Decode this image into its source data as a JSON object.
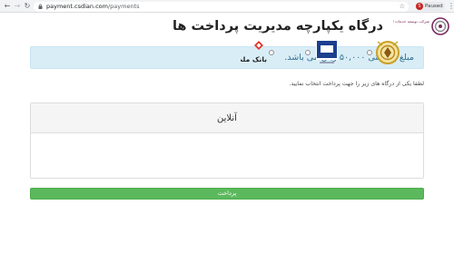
{
  "browser": {
    "url_host": "payment.csdian.com",
    "url_path": "/payments",
    "profile_initial": "S",
    "profile_label": "Paused"
  },
  "header": {
    "logo_text": "شرکت توسعه خدمات الکترونیکی آدینه",
    "title": "درگاه یکپارچه مدیریت پرداخت ها"
  },
  "alert": {
    "text": "مبلغ پرداختی ۵۰,۰۰۰ ریال می باشد."
  },
  "hint": "لطفا یکی از درگاه های زیر را جهت پرداخت انتخاب نمایید.",
  "panel": {
    "title": "آنلاین"
  },
  "gateways": [
    {
      "name": "bank-melli"
    },
    {
      "name": "saman"
    },
    {
      "name": "bank-mellat",
      "label": "بانک ملت"
    }
  ],
  "pay_button": "پرداخت",
  "colors": {
    "alert_bg": "#d9edf7",
    "alert_text": "#31708f",
    "pay_button": "#5cb85c",
    "mellat_red": "#e2352c",
    "saman_blue": "#1b3f8f",
    "melli_gold": "#c9a227"
  }
}
